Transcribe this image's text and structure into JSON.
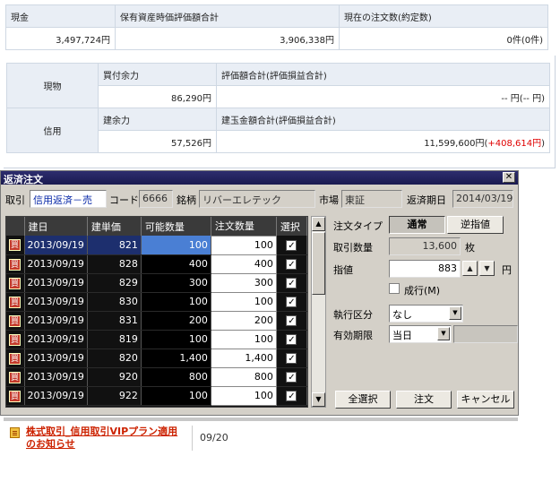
{
  "summary": {
    "headers": [
      "現金",
      "保有資産時価評価額合計",
      "現在の注文数(約定数)"
    ],
    "values": [
      "3,497,724円",
      "3,906,338円",
      "0件(0件)"
    ]
  },
  "detail": {
    "genbutsu": {
      "label": "現物",
      "h1": "買付余力",
      "h2": "評価額合計(評価損益合計)",
      "v1": "86,290円",
      "v2": "-- 円(-- 円)"
    },
    "shinyo": {
      "label": "信用",
      "h1": "建余力",
      "h2": "建玉金額合計(評価損益合計)",
      "v1": "57,526円",
      "v2_main": "11,599,600円(",
      "v2_red": "+408,614円",
      "v2_end": ")"
    }
  },
  "dialog": {
    "title": "返済注文",
    "close": "✕",
    "torihiki_label": "取引",
    "torihiki_value": "信用返済－売",
    "code_label": "コード",
    "code_value": "6666",
    "meigara_label": "銘柄",
    "meigara_value": "リバーエレテック",
    "shijo_label": "市場",
    "shijo_value": "東証",
    "kigen_label": "返済期日",
    "kigen_value": "2014/03/19",
    "grid_headers": [
      "建日",
      "建単価",
      "可能数量",
      "注文数量",
      "選択"
    ],
    "buy_mark": "買",
    "rows": [
      {
        "date": "2013/09/19",
        "price": "821",
        "avail": "100",
        "qty": "100"
      },
      {
        "date": "2013/09/19",
        "price": "828",
        "avail": "400",
        "qty": "400"
      },
      {
        "date": "2013/09/19",
        "price": "829",
        "avail": "300",
        "qty": "300"
      },
      {
        "date": "2013/09/19",
        "price": "830",
        "avail": "100",
        "qty": "100"
      },
      {
        "date": "2013/09/19",
        "price": "831",
        "avail": "200",
        "qty": "200"
      },
      {
        "date": "2013/09/19",
        "price": "819",
        "avail": "100",
        "qty": "100"
      },
      {
        "date": "2013/09/19",
        "price": "820",
        "avail": "1,400",
        "qty": "1,400"
      },
      {
        "date": "2013/09/19",
        "price": "920",
        "avail": "800",
        "qty": "800"
      },
      {
        "date": "2013/09/19",
        "price": "922",
        "avail": "100",
        "qty": "100"
      }
    ],
    "order_type_label": "注文タイプ",
    "order_type_normal": "通常",
    "order_type_stop": "逆指値",
    "qty_label": "取引数量",
    "qty_value": "13,600",
    "qty_unit": "枚",
    "price_label": "指値",
    "price_value": "883",
    "price_unit": "円",
    "market_label": "成行(M)",
    "exec_label": "執行区分",
    "exec_value": "なし",
    "expiry_label": "有効期限",
    "expiry_value": "当日",
    "select_all": "全選択",
    "order_btn": "注文",
    "cancel_btn": "キャンセル"
  },
  "news": {
    "title": "株式取引_信用取引VIPプラン適用のお知らせ",
    "date": "09/20"
  }
}
